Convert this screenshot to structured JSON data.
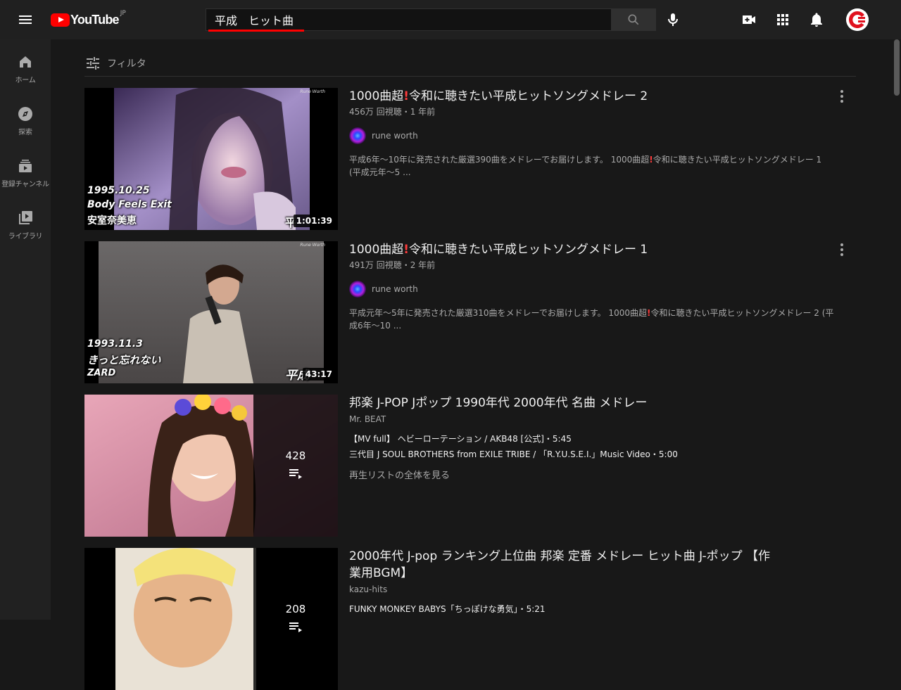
{
  "header": {
    "logo_text": "YouTube",
    "logo_region": "JP",
    "search_value": "平成　ヒット曲",
    "icons": [
      "menu-icon",
      "search-icon",
      "mic-icon",
      "create-video-icon",
      "apps-icon",
      "bell-icon"
    ]
  },
  "guide": {
    "items": [
      {
        "label": "ホーム",
        "icon": "home-icon"
      },
      {
        "label": "探索",
        "icon": "explore-icon"
      },
      {
        "label": "登録チャンネル",
        "icon": "subscriptions-icon"
      },
      {
        "label": "ライブラリ",
        "icon": "library-icon"
      }
    ]
  },
  "filter": {
    "label": "フィルタ"
  },
  "results": [
    {
      "title_a": "1000曲超",
      "title_bang": "!",
      "title_b": "令和に聴きたい平成ヒットソングメドレー 2",
      "meta": "456万 回視聴・1 年前",
      "channel": "rune worth",
      "desc_a": "平成6年〜10年に発売された厳選390曲をメドレーでお届けします。 1000曲超",
      "desc_bang": "!",
      "desc_b": "令和に聴きたい平成ヒットソングメドレー 1 (平成元年〜5 ...",
      "duration": "1:01:39",
      "thumb_lines": [
        "1995.10.25",
        "Body Feels Exit",
        "安室奈美恵"
      ],
      "thumb_corner": "Rune Worth",
      "thumb_partial": "平"
    },
    {
      "title_a": "1000曲超",
      "title_bang": "!",
      "title_b": "令和に聴きたい平成ヒットソングメドレー 1",
      "meta": "491万 回視聴・2 年前",
      "channel": "rune worth",
      "desc_a": "平成元年〜5年に発売された厳選310曲をメドレーでお届けします。 1000曲超",
      "desc_bang": "!",
      "desc_b": "令和に聴きたい平成ヒットソングメドレー 2 (平成6年〜10 ...",
      "duration": "43:17",
      "thumb_lines": [
        "1993.11.3",
        "きっと忘れない",
        "ZARD"
      ],
      "thumb_corner": "Rune Worth",
      "thumb_partial": "平成"
    },
    {
      "title": "邦楽 J-POP Jポップ 1990年代 2000年代 名曲 メドレー",
      "channel": "Mr. BEAT",
      "lines": [
        "【MV full】 ヘビーローテーション / AKB48 [公式]・5:45",
        "三代目 J SOUL BROTHERS from EXILE TRIBE / 「R.Y.U.S.E.I.」Music Video・5:00"
      ],
      "view_all": "再生リストの全体を見る",
      "count": "428"
    },
    {
      "title": "2000年代 J-pop ランキング上位曲 邦楽 定番 メドレー ヒット曲 J-ポップ 【作業用BGM】",
      "channel": "kazu-hits",
      "lines": [
        "FUNKY MONKEY BABYS「ちっぽけな勇気」・5:21"
      ],
      "count": "208"
    }
  ]
}
